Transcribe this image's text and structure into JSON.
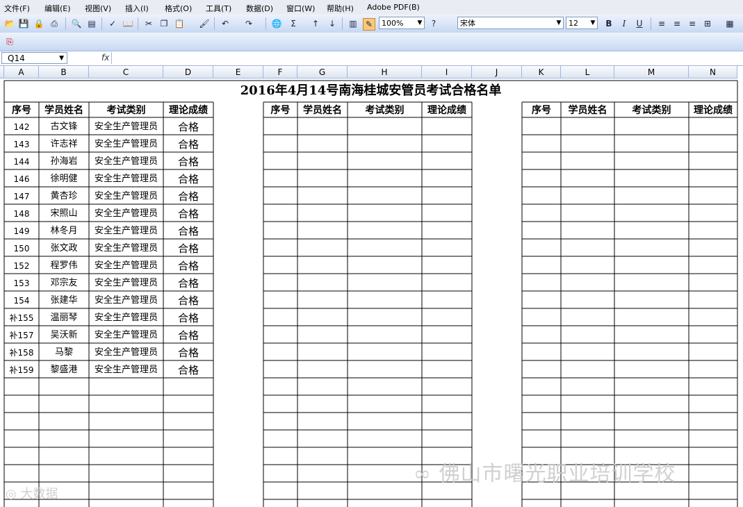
{
  "menu": [
    "文件(F)",
    "编辑(E)",
    "视图(V)",
    "插入(I)",
    "格式(O)",
    "工具(T)",
    "数据(D)",
    "窗口(W)",
    "帮助(H)",
    "Adobe PDF(B)"
  ],
  "toolbar": {
    "zoom": "100%",
    "font_name": "宋体",
    "font_size": "12"
  },
  "formula_bar": {
    "name_box": "Q14",
    "fx_label": "fx"
  },
  "columns": [
    "A",
    "B",
    "C",
    "D",
    "E",
    "F",
    "G",
    "H",
    "I",
    "J",
    "K",
    "L",
    "M",
    "N"
  ],
  "sheet": {
    "title": "2016年4月14号南海桂城安管员考试合格名单",
    "headers": [
      "序号",
      "学员姓名",
      "考试类别",
      "理论成绩"
    ],
    "rows": [
      [
        "142",
        "古文锋",
        "安全生产管理员",
        "合格"
      ],
      [
        "143",
        "许志祥",
        "安全生产管理员",
        "合格"
      ],
      [
        "144",
        "孙海岩",
        "安全生产管理员",
        "合格"
      ],
      [
        "146",
        "徐明健",
        "安全生产管理员",
        "合格"
      ],
      [
        "147",
        "黄杏珍",
        "安全生产管理员",
        "合格"
      ],
      [
        "148",
        "宋照山",
        "安全生产管理员",
        "合格"
      ],
      [
        "149",
        "林冬月",
        "安全生产管理员",
        "合格"
      ],
      [
        "150",
        "张文政",
        "安全生产管理员",
        "合格"
      ],
      [
        "152",
        "程罗伟",
        "安全生产管理员",
        "合格"
      ],
      [
        "153",
        "邓宗友",
        "安全生产管理员",
        "合格"
      ],
      [
        "154",
        "张建华",
        "安全生产管理员",
        "合格"
      ],
      [
        "补155",
        "温丽琴",
        "安全生产管理员",
        "合格"
      ],
      [
        "补157",
        "吴沃新",
        "安全生产管理员",
        "合格"
      ],
      [
        "补158",
        "马黎",
        "安全生产管理员",
        "合格"
      ],
      [
        "补159",
        "黎盛港",
        "安全生产管理员",
        "合格"
      ]
    ]
  },
  "watermark": {
    "text": "佛山市曙光职业培训学校",
    "brand": "大数据"
  }
}
